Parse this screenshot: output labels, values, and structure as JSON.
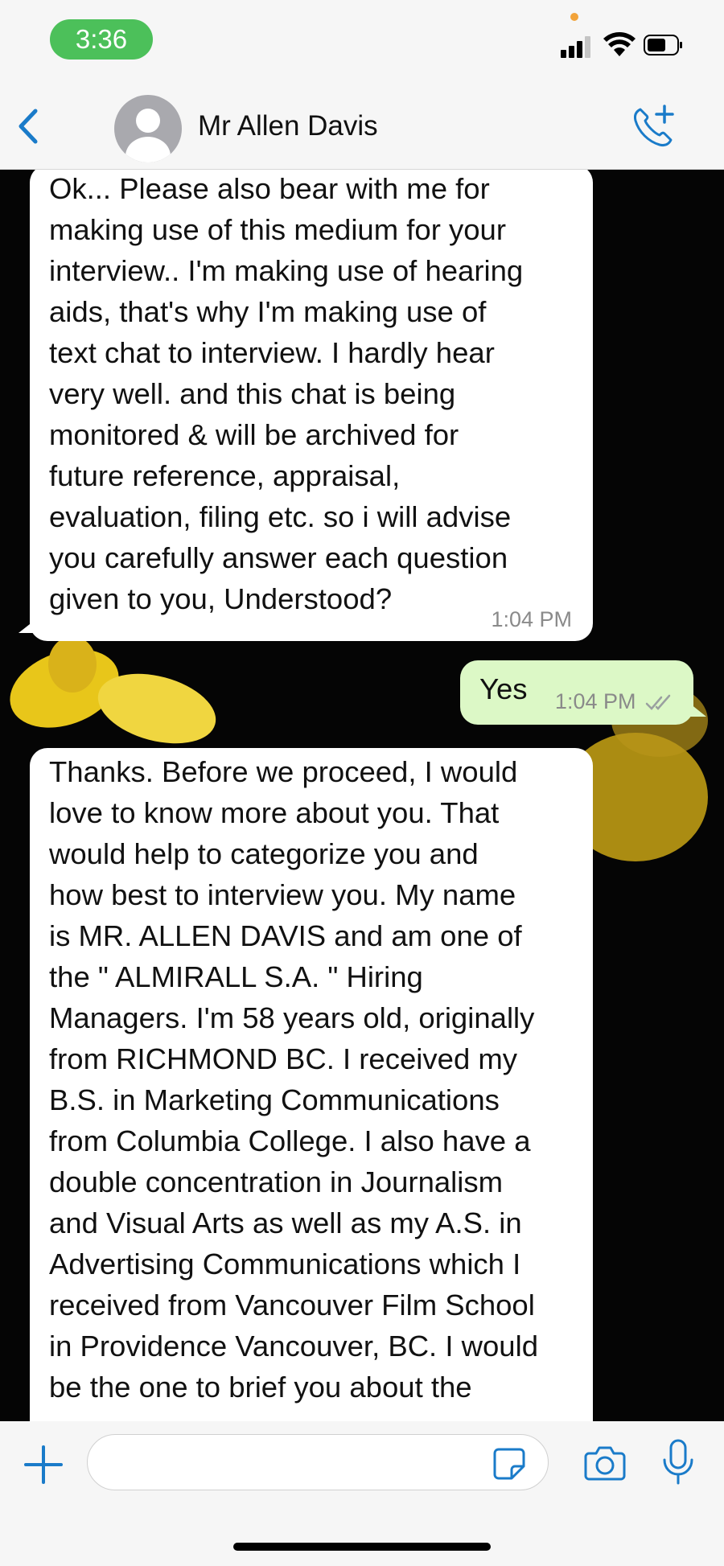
{
  "status_bar": {
    "time": "3:36"
  },
  "header": {
    "contact_name": "Mr Allen Davis"
  },
  "messages": [
    {
      "direction": "incoming",
      "text": "Ok... Please also bear with me for\nmaking use of this medium for your\ninterview.. I'm making use of hearing\naids, that's why I'm making use of\ntext chat to interview. I hardly hear\nvery well. and this chat is being\nmonitored & will be archived for\nfuture reference, appraisal,\nevaluation, filing etc. so i will advise\nyou carefully answer each question\ngiven to you, Understood?",
      "time": "1:04 PM"
    },
    {
      "direction": "outgoing",
      "text": "Yes",
      "time": "1:04 PM",
      "status": "read"
    },
    {
      "direction": "incoming",
      "text": "Thanks. Before we proceed, I would\nlove to know more about you. That\nwould help to categorize you and\nhow best to interview you. My name\nis MR. ALLEN DAVIS and am one of\nthe \" ALMIRALL S.A. \" Hiring\nManagers. I'm 58 years old, originally\nfrom RICHMOND BC. I received my\nB.S. in Marketing Communications\nfrom Columbia College. I also have a\ndouble concentration in Journalism\nand Visual Arts as well as my A.S. in\nAdvertising Communications which I\nreceived from Vancouver Film School\nin Providence Vancouver, BC. I would\nbe the one to brief you about the"
    }
  ],
  "input": {
    "placeholder": ""
  },
  "colors": {
    "accent": "#1a7bc9",
    "outgoing_bubble": "#dcf8c6",
    "incoming_bubble": "#ffffff",
    "time_pill": "#4cc05a"
  },
  "icons": [
    "back-icon",
    "avatar",
    "call-add-icon",
    "check-double-icon",
    "chevron-down-icon",
    "plus-icon",
    "sticker-icon",
    "camera-icon",
    "mic-icon"
  ]
}
